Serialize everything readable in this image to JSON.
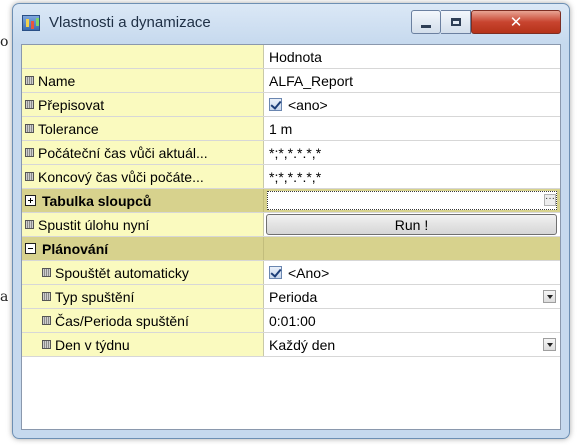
{
  "window": {
    "title": "Vlastnosti a dynamizace",
    "controls": {
      "minimize": "minimize",
      "maximize": "maximize",
      "close": "close"
    }
  },
  "background": {
    "fragments": [
      "o",
      "a"
    ]
  },
  "grid": {
    "header": {
      "value": "Hodnota"
    },
    "rows": [
      {
        "label": "Name",
        "value": "ALFA_Report"
      },
      {
        "label": "Přepisovat",
        "value": "<ano>"
      },
      {
        "label": "Tolerance",
        "value": "1 m"
      },
      {
        "label": "Počáteční čas vůči aktuál...",
        "value": "*;*,*.*.*,*"
      },
      {
        "label": "Koncový čas vůči počáte...",
        "value": "*;*,*.*.*,*"
      },
      {
        "label": "Tabulka sloupců",
        "value": ""
      },
      {
        "label": "Spustit úlohu nyní",
        "value": "Run !"
      },
      {
        "label": "Plánování",
        "value": ""
      },
      {
        "label": "Spouštět automaticky",
        "value": "<Ano>"
      },
      {
        "label": "Typ spuštění",
        "value": "Perioda"
      },
      {
        "label": "Čas/Perioda spuštění",
        "value": "0:01:00"
      },
      {
        "label": "Den v týdnu",
        "value": "Každý den"
      }
    ]
  }
}
